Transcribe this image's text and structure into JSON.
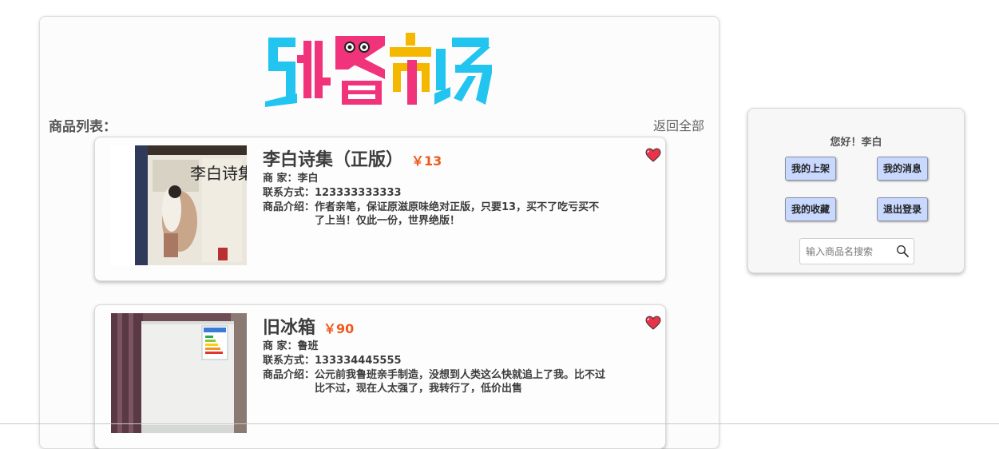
{
  "logo": {
    "text": "跳蚤市场"
  },
  "product_list": {
    "title": "商品列表：",
    "return_all": "返回全部",
    "items": [
      {
        "name": "李白诗集（正版）",
        "price": "￥13",
        "seller_label": "商 家：",
        "seller": "李白",
        "contact_label": "联系方式：",
        "contact": "123333333333",
        "desc_label": "商品介绍：",
        "desc": "作者亲笔，保证原滋原味绝对正版，只要13，买不了吃亏买不了上当！仅此一份，世界绝版！",
        "image_icon": "book-cover-image",
        "cover_text": "李白诗集"
      },
      {
        "name": "旧冰箱",
        "price": "￥90",
        "seller_label": "商 家：",
        "seller": "鲁班",
        "contact_label": "联系方式：",
        "contact": "133334445555",
        "desc_label": "商品介绍：",
        "desc": "公元前我鲁班亲手制造，没想到人类这么快就追上了我。比不过比不过，现在人太强了，我转行了，低价出售",
        "image_icon": "fridge-photo-image"
      }
    ]
  },
  "user_panel": {
    "greeting": "您好！李白",
    "buttons": {
      "my_listings": "我的上架",
      "my_messages": "我的消息",
      "my_favorites": "我的收藏",
      "logout": "退出登录"
    },
    "search": {
      "placeholder": "输入商品名搜索",
      "value": ""
    }
  },
  "colors": {
    "price": "#ee5a1e",
    "button_bg": "#c8d8ff",
    "heart": "#e8334a",
    "logo_cyan": "#22c4f0",
    "logo_pink": "#f0337a",
    "logo_yellow": "#f5b800"
  }
}
